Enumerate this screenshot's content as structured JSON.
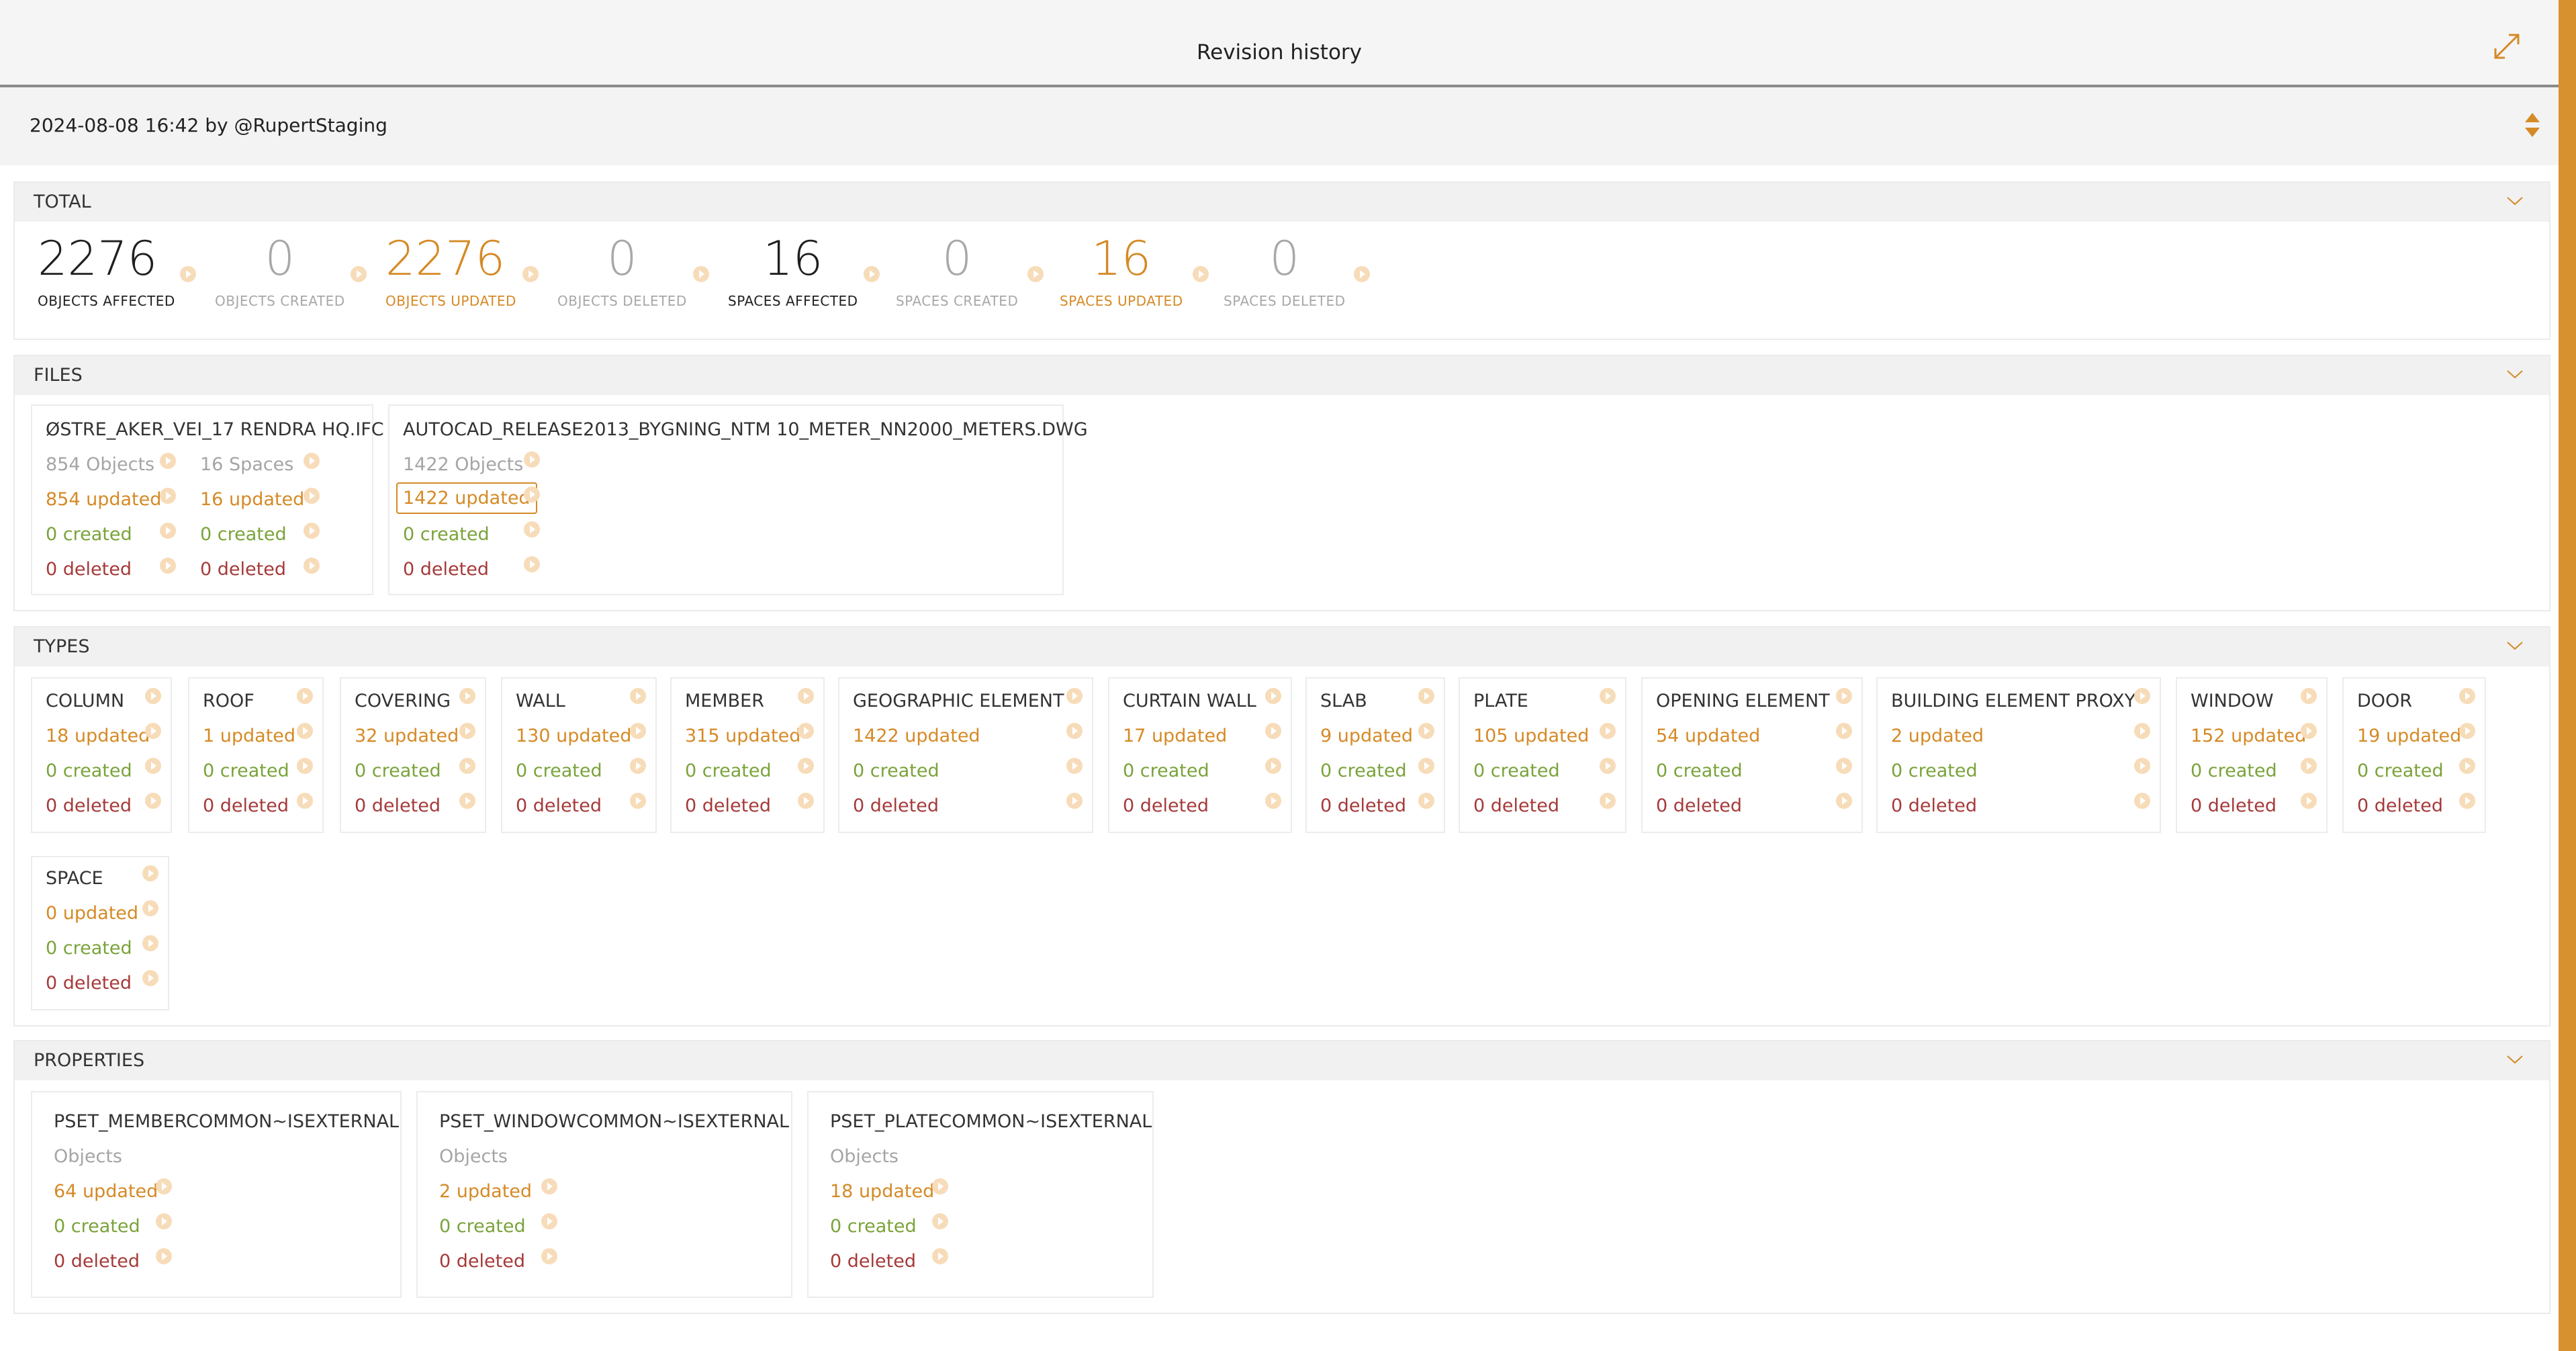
{
  "header": {
    "title": "Revision history"
  },
  "revision": {
    "selected": "2024-08-08 16:42 by @RupertStaging"
  },
  "total": {
    "title": "TOTAL",
    "stats": [
      {
        "value": "2276",
        "label": "OBJECTS AFFECTED"
      },
      {
        "value": "0",
        "label": "OBJECTS CREATED"
      },
      {
        "value": "2276",
        "label": "OBJECTS UPDATED"
      },
      {
        "value": "0",
        "label": "OBJECTS DELETED"
      },
      {
        "value": "16",
        "label": "SPACES AFFECTED"
      },
      {
        "value": "0",
        "label": "SPACES CREATED"
      },
      {
        "value": "16",
        "label": "SPACES UPDATED"
      },
      {
        "value": "0",
        "label": "SPACES DELETED"
      }
    ]
  },
  "files": {
    "title": "FILES",
    "items": [
      {
        "name": "ØSTRE_AKER_VEI_17 RENDRA HQ.IFC",
        "objects": {
          "count": "854 Objects",
          "updated": "854 updated",
          "created": "0 created",
          "deleted": "0 deleted"
        },
        "spaces": {
          "count": "16 Spaces",
          "updated": "16 updated",
          "created": "0 created",
          "deleted": "0 deleted"
        }
      },
      {
        "name": "AUTOCAD_RELEASE2013_BYGNING_NTM 10_METER_NN2000_METERS.DWG",
        "objects": {
          "count": "1422 Objects",
          "updated": "1422 updated",
          "created": "0 created",
          "deleted": "0 deleted"
        }
      }
    ]
  },
  "types": {
    "title": "TYPES",
    "items": [
      {
        "name": "COLUMN",
        "updated": "18 updated",
        "created": "0 created",
        "deleted": "0 deleted"
      },
      {
        "name": "ROOF",
        "updated": "1 updated",
        "created": "0 created",
        "deleted": "0 deleted"
      },
      {
        "name": "COVERING",
        "updated": "32 updated",
        "created": "0 created",
        "deleted": "0 deleted"
      },
      {
        "name": "WALL",
        "updated": "130 updated",
        "created": "0 created",
        "deleted": "0 deleted"
      },
      {
        "name": "MEMBER",
        "updated": "315 updated",
        "created": "0 created",
        "deleted": "0 deleted"
      },
      {
        "name": "GEOGRAPHIC ELEMENT",
        "updated": "1422 updated",
        "created": "0 created",
        "deleted": "0 deleted"
      },
      {
        "name": "CURTAIN WALL",
        "updated": "17 updated",
        "created": "0 created",
        "deleted": "0 deleted"
      },
      {
        "name": "SLAB",
        "updated": "9 updated",
        "created": "0 created",
        "deleted": "0 deleted"
      },
      {
        "name": "PLATE",
        "updated": "105 updated",
        "created": "0 created",
        "deleted": "0 deleted"
      },
      {
        "name": "OPENING ELEMENT",
        "updated": "54 updated",
        "created": "0 created",
        "deleted": "0 deleted"
      },
      {
        "name": "BUILDING ELEMENT PROXY",
        "updated": "2 updated",
        "created": "0 created",
        "deleted": "0 deleted"
      },
      {
        "name": "WINDOW",
        "updated": "152 updated",
        "created": "0 created",
        "deleted": "0 deleted"
      },
      {
        "name": "DOOR",
        "updated": "19 updated",
        "created": "0 created",
        "deleted": "0 deleted"
      },
      {
        "name": "SPACE",
        "updated": "0 updated",
        "created": "0 created",
        "deleted": "0 deleted"
      }
    ]
  },
  "properties": {
    "title": "PROPERTIES",
    "items": [
      {
        "name": "PSET_MEMBERCOMMON~ISEXTERNAL",
        "sub": "Objects",
        "updated": "64 updated",
        "created": "0 created",
        "deleted": "0 deleted"
      },
      {
        "name": "PSET_WINDOWCOMMON~ISEXTERNAL",
        "sub": "Objects",
        "updated": "2 updated",
        "created": "0 created",
        "deleted": "0 deleted"
      },
      {
        "name": "PSET_PLATECOMMON~ISEXTERNAL",
        "sub": "Objects",
        "updated": "18 updated",
        "created": "0 created",
        "deleted": "0 deleted"
      }
    ]
  },
  "colors": {
    "accent": "#d58a26",
    "created": "#7aa33a",
    "deleted": "#a63a3a",
    "muted": "#a8a8a8"
  },
  "icons": [
    "expand-icon",
    "sort-icon",
    "chevron-down-icon",
    "arrow-right-icon"
  ]
}
